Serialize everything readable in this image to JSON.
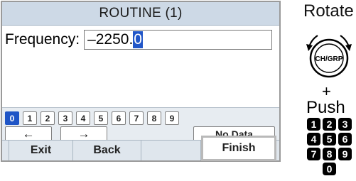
{
  "screen": {
    "title": "ROUTINE (1)",
    "frequency_label": "Frequency:",
    "frequency_value": "–2250.",
    "frequency_cursor": "0",
    "digit_keys": [
      "0",
      "1",
      "2",
      "3",
      "4",
      "5",
      "6",
      "7",
      "8",
      "9"
    ],
    "selected_digit": "0",
    "arrow_left": "←",
    "arrow_right": "→",
    "no_data_label": "No Data",
    "softkeys": {
      "exit": "Exit",
      "back": "Back",
      "empty": "",
      "finish": "Finish"
    }
  },
  "side": {
    "rotate_label": "Rotate",
    "knob_label": "CH/GRP",
    "plus": "+",
    "push_label": "Push",
    "keypad_rows": [
      [
        "1",
        "2",
        "3"
      ],
      [
        "4",
        "5",
        "6"
      ],
      [
        "7",
        "8",
        "9"
      ],
      [
        "0"
      ]
    ]
  },
  "colors": {
    "title_bar": "#cdd9e6",
    "selection": "#1f55c6",
    "keys_area": "#e7ecf1"
  }
}
